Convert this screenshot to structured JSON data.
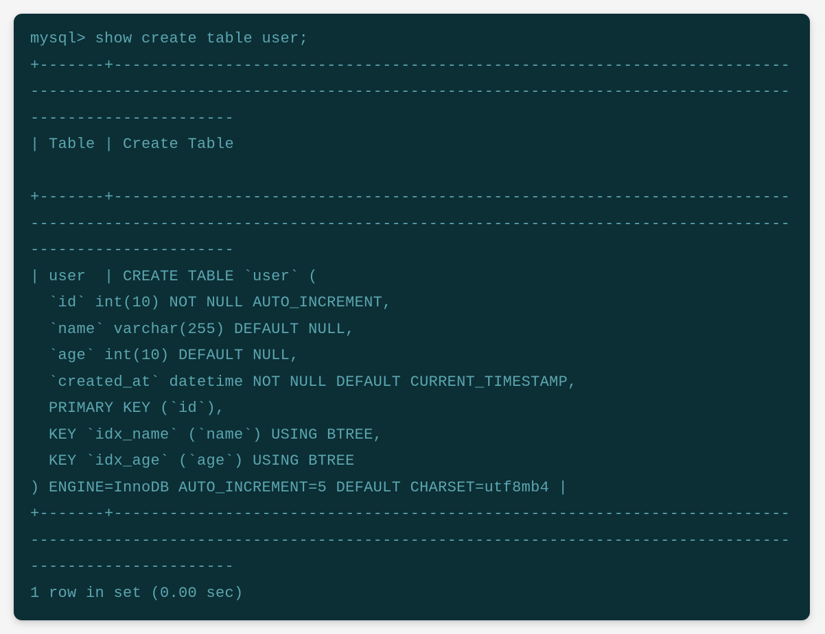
{
  "terminal": {
    "prompt": "mysql> ",
    "command": "show create table user;",
    "separator1": "+-------+---------------------------------------------------------------------------------------------------------------------------------------------------------------------------------",
    "header_row": "| Table | Create Table",
    "blank_line": "",
    "separator2": "+-------+---------------------------------------------------------------------------------------------------------------------------------------------------------------------------------",
    "table_name_prefix": "| user  | ",
    "create_line": "CREATE TABLE `user` (",
    "col_id": "  `id` int(10) NOT NULL AUTO_INCREMENT,",
    "col_name": "  `name` varchar(255) DEFAULT NULL,",
    "col_age": "  `age` int(10) DEFAULT NULL,",
    "col_created_at": "  `created_at` datetime NOT NULL DEFAULT CURRENT_TIMESTAMP,",
    "pk": "  PRIMARY KEY (`id`),",
    "idx_name": "  KEY `idx_name` (`name`) USING BTREE,",
    "idx_age": "  KEY `idx_age` (`age`) USING BTREE",
    "engine_line": ") ENGINE=InnoDB AUTO_INCREMENT=5 DEFAULT CHARSET=utf8mb4 |",
    "separator3": "+-------+---------------------------------------------------------------------------------------------------------------------------------------------------------------------------------",
    "result_summary": "1 row in set (0.00 sec)"
  }
}
